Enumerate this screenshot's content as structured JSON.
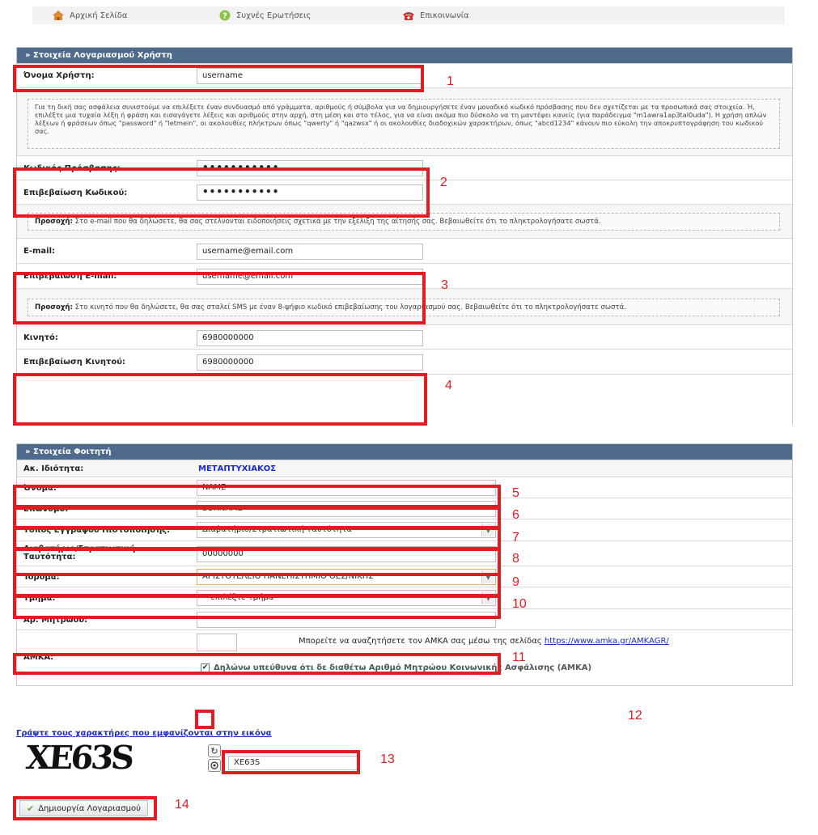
{
  "nav": {
    "home": "Αρχική Σελίδα",
    "faq": "Συχνές Ερωτήσεις",
    "contact": "Επικοινωνία"
  },
  "account": {
    "header": "» Στοιχεία Λογαριασμού Χρήστη",
    "username_label": "Όνομα Χρήστη:",
    "username_value": "username",
    "password_note": "Για τη δική σας ασφάλεια συνιστούμε να επιλέξετε έναν συνδυασμό από γράμματα, αριθμούς ή σύμβολα για να δημιουργήσετε έναν μοναδικό κωδικό πρόσβασης που δεν σχετίζεται με τα προσωπικά σας στοιχεία. Ή, επιλέξτε μια τυχαία λέξη ή φράση και εισαγάγετε λέξεις και αριθμούς στην αρχή, στη μέση και στο τέλος, για να είναι ακόμα πιο δύσκολο να τη μαντέψει κανείς (για παράδειγμα \"m1awra1ap3tal0uda\"). Η χρήση απλών λέξεων ή φράσεων όπως \"password\" ή \"letmein\", οι ακολουθίες πλήκτρων όπως \"qwerty\" ή \"qazwsx\" ή οι ακολουθίες διαδοχικών χαρακτήρων, όπως \"abcd1234\" κάνουν πιο εύκολη την αποκρυπτογράφηση του κωδικού σας.",
    "password_label": "Κωδικός Πρόσβασης:",
    "password_value": "•••••••••••",
    "password_confirm_label": "Επιβεβαίωση Κωδικού:",
    "password_confirm_value": "•••••••••••",
    "email_note_bold": "Προσοχή:",
    "email_note": " Στο e-mail που θα δηλώσετε, θα σας στέλνονται ειδοποιήσεις σχετικά με την εξέλιξη της αίτησής σας. Βεβαιωθείτε ότι το πληκτρολογήσατε σωστά.",
    "email_label": "E-mail:",
    "email_value": "username@email.com",
    "email_confirm_label": "Επιβεβαίωση E-mail:",
    "email_confirm_value": "username@email.com",
    "mobile_note_bold": "Προσοχή:",
    "mobile_note": " Στο κινητό που θα δηλώσετε, θα σας σταλεί SMS με έναν 8-ψήφιο κωδικό επιβεβαίωσης του λογαριασμού σας. Βεβαιωθείτε ότι το πληκτρολογήσατε σωστά.",
    "mobile_label": "Κινητό:",
    "mobile_value": "6980000000",
    "mobile_confirm_label": "Επιβεβαίωση Κινητού:",
    "mobile_confirm_value": "6980000000"
  },
  "student": {
    "header": "» Στοιχεία Φοιτητή",
    "status_label": "Ακ. Ιδιότητα:",
    "status_value": "ΜΕΤΑΠΤΥΧΙΑΚΟΣ",
    "first_name_label": "Όνομα:",
    "first_name_value": "NAME",
    "last_name_label": "Επώνυμο:",
    "last_name_value": "SURNAME",
    "doc_type_label": "Τύπος Εγγράφου Πιστοποίησης:",
    "doc_type_value": "Διαβατήριο/Στρατιωτική Ταυτότητα",
    "doc_number_label": "Διαβατήριο/Στρατιωτική Ταυτότητα:",
    "doc_number_value": "00000000",
    "institution_label": "Ίδρυμα:",
    "institution_value": "ΑΡΙΣΤΟΤΕΛΕΙΟ ΠΑΝΕΠΙΣΤΗΜΙΟ ΘΕΣ/ΝΙΚΗΣ",
    "department_label": "Τμήμα:",
    "department_value": "-- επιλέξτε τμήμα --",
    "registry_label": "Αρ. Μητρώου:",
    "registry_value": "",
    "amka_label": "ΑΜΚΑ:",
    "amka_value": "",
    "amka_hint": "Μπορείτε να αναζητήσετε τον ΑΜΚΑ σας μέσω της σελίδας",
    "amka_link": "https://www.amka.gr/AMKAGR/",
    "amka_checkbox_label": "Δηλώνω υπεύθυνα ότι δε διαθέτω Αριθμό Μητρώου Κοινωνικής Ασφάλισης (ΑΜΚΑ)"
  },
  "captcha": {
    "prompt": "Γράψτε τους χαρακτήρες που εμφανίζονται στην εικόνα",
    "image_text": "XE63S",
    "value": "XE63S"
  },
  "submit_label": "Δημιουργία Λογαριασμού",
  "markers": [
    "1",
    "2",
    "3",
    "4",
    "5",
    "6",
    "7",
    "8",
    "9",
    "10",
    "11",
    "12",
    "13",
    "14"
  ]
}
